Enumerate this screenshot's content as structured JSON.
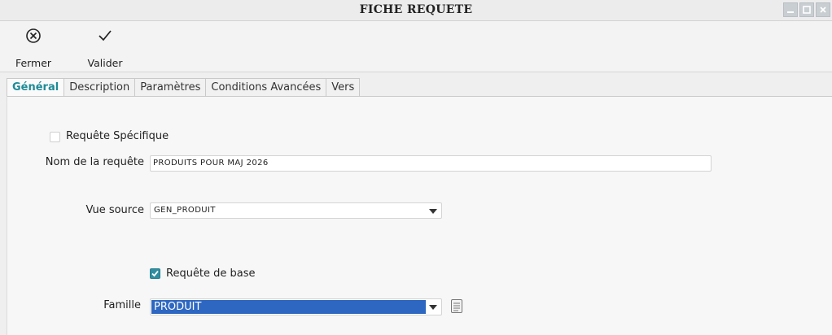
{
  "window": {
    "title": "FICHE REQUETE",
    "controls": [
      "minimize-icon",
      "maximize-icon",
      "close-icon"
    ]
  },
  "toolbar": {
    "close": {
      "label": "Fermer",
      "icon": "circle-x-icon"
    },
    "validate": {
      "label": "Valider",
      "icon": "checkmark-icon"
    }
  },
  "tabs": [
    {
      "label": "Général",
      "active": true
    },
    {
      "label": "Description",
      "active": false
    },
    {
      "label": "Paramètres",
      "active": false
    },
    {
      "label": "Conditions Avancées",
      "active": false
    },
    {
      "label": "Vers",
      "active": false
    }
  ],
  "form": {
    "specific": {
      "label": "Requête Spécifique",
      "checked": false
    },
    "name": {
      "label": "Nom de la requête",
      "value": "PRODUITS POUR MAJ 2026"
    },
    "source": {
      "label": "Vue source",
      "value": "GEN_PRODUIT"
    },
    "base": {
      "label": "Requête de base",
      "checked": true
    },
    "family": {
      "label": "Famille",
      "value": "PRODUIT"
    }
  },
  "colors": {
    "accent": "#1e8a96",
    "checkbox": "#2f8fa0",
    "selection": "#2e67c2"
  }
}
